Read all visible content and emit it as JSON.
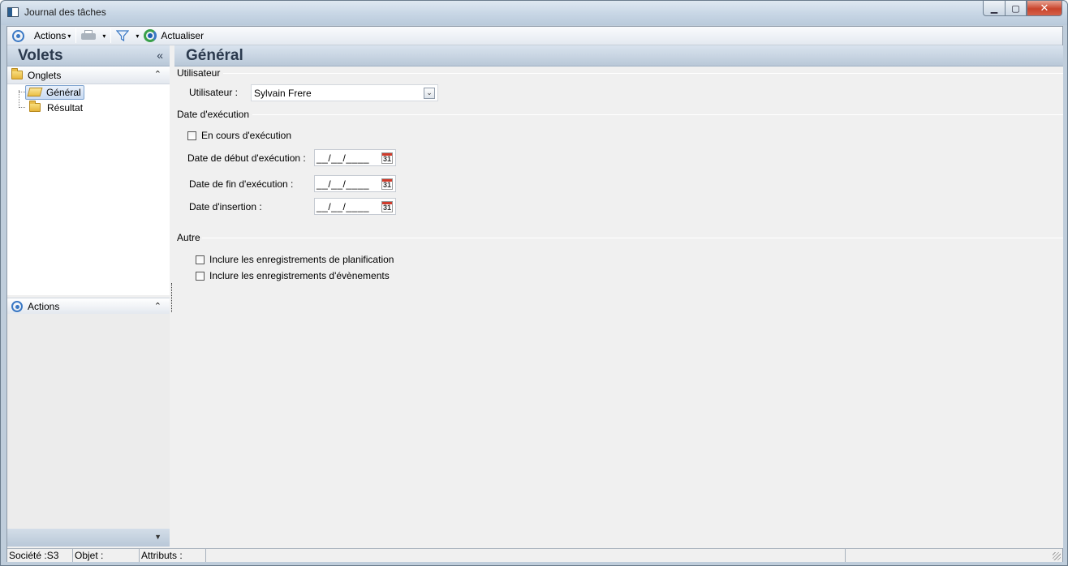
{
  "window": {
    "title": "Journal des tâches",
    "close_glyph": "✕",
    "min_glyph": "▁",
    "max_glyph": "▢"
  },
  "toolbar": {
    "actions_label": "Actions",
    "refresh_label": "Actualiser",
    "caret": "▾"
  },
  "left_pane": {
    "title": "Volets",
    "collapse_glyph": "«",
    "groups": {
      "onglets": {
        "label": "Onglets",
        "chevron": "⌃"
      },
      "actions": {
        "label": "Actions",
        "chevron": "⌃"
      }
    },
    "tree_items": [
      {
        "label": "Général",
        "selected": true
      },
      {
        "label": "Résultat",
        "selected": false
      }
    ],
    "footer_chevron": "▼"
  },
  "main": {
    "title": "Général",
    "sections": {
      "utilisateur": {
        "title": "Utilisateur",
        "user_label": "Utilisateur :",
        "user_value": "Sylvain Frere",
        "dropdown_glyph": "⌄"
      },
      "date_execution": {
        "title": "Date d'exécution",
        "in_progress_label": "En cours d'exécution",
        "start_label": "Date de début d'exécution  :",
        "end_label": "Date de fin d'exécution :",
        "insert_label": "Date d'insertion :",
        "start_value": "__/__/____",
        "end_value": "__/__/____",
        "insert_value": "__/__/____",
        "calendar_day": "31"
      },
      "autre": {
        "title": "Autre",
        "include_planning_label": "Inclure les enregistrements de planification",
        "include_events_label": "Inclure les enregistrements d'évènements"
      }
    }
  },
  "statusbar": {
    "societe": "Société :S3",
    "objet": "Objet :",
    "attributs": "Attributs :"
  },
  "icons": {
    "actions": "actions-ring-icon",
    "print": "printer-icon",
    "filter": "funnel-icon",
    "refresh": "refresh-icon",
    "folder": "folder-icon",
    "calendar": "calendar-icon"
  },
  "colors": {
    "header_gradient_top": "#d9e3ee",
    "header_gradient_bottom": "#b9c8d8",
    "accent_blue": "#3a78c4",
    "close_red": "#c9442c"
  }
}
